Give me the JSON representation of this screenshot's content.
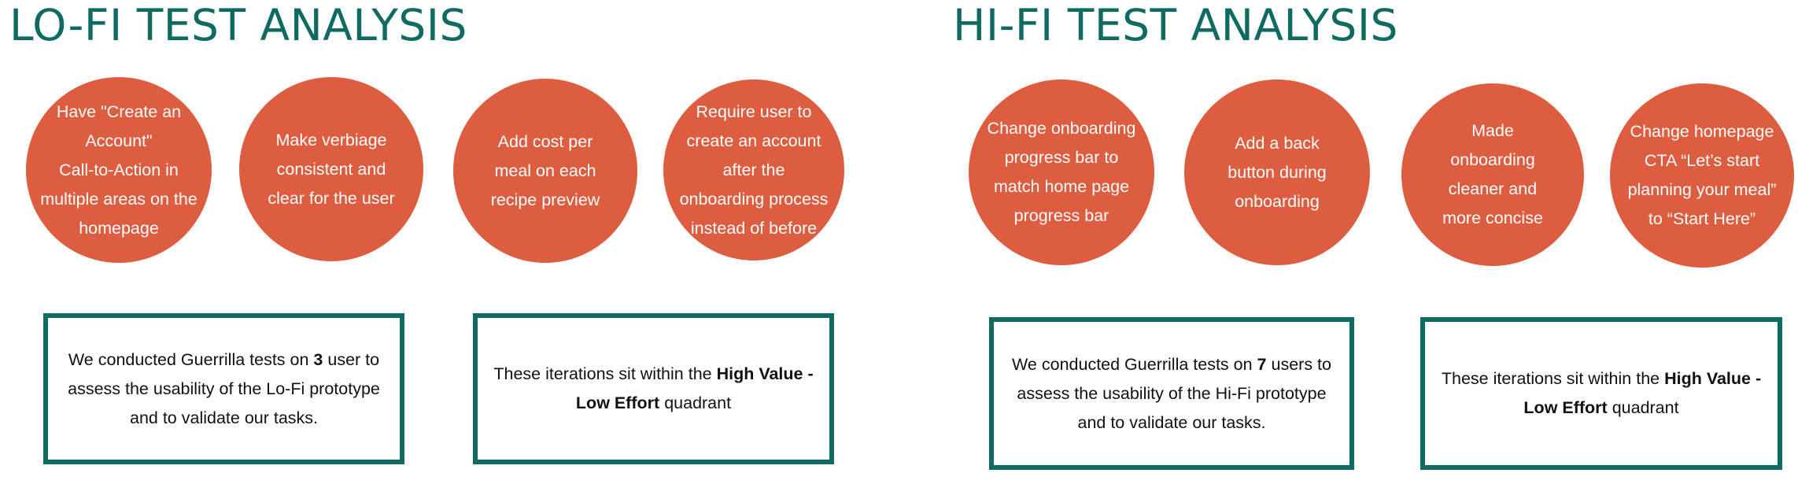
{
  "colors": {
    "accent": "#0f6b61",
    "circle": "#dc5d3f",
    "text": "#111111",
    "background": "#ffffff"
  },
  "lofi": {
    "title": "LO-FI TEST ANALYSIS",
    "circles": [
      "Have \"Create an\nAccount\"\nCall-to-Action in\nmultiple areas on the\nhomepage",
      "Make verbiage\nconsistent and\nclear for the user",
      "Add cost per\nmeal on each\nrecipe preview",
      "Require user to\ncreate an account\nafter the\nonboarding process\ninstead of before"
    ],
    "box1": {
      "prefix": "We conducted Guerrilla tests on ",
      "count": "3",
      "suffix": " user to assess the usability of the Lo-Fi prototype and to validate our tasks."
    },
    "box2": {
      "prefix": "These iterations sit within the ",
      "bold": "High Value - Low Effort",
      "suffix": " quadrant"
    }
  },
  "hifi": {
    "title": "HI-FI TEST ANALYSIS",
    "circles": [
      "Change onboarding\nprogress bar to\nmatch home page\nprogress bar",
      "Add a back\nbutton during\nonboarding",
      "Made\nonboarding\ncleaner and\nmore concise",
      "Change homepage\nCTA “Let’s start\nplanning your meal”\nto “Start Here”"
    ],
    "box1": {
      "prefix": "We conducted Guerrilla tests on ",
      "count": "7",
      "suffix": " users to assess the usability of the Hi-Fi prototype and to validate our tasks."
    },
    "box2": {
      "prefix": "These iterations sit within the ",
      "bold": "High Value - Low Effort",
      "suffix": " quadrant"
    }
  }
}
